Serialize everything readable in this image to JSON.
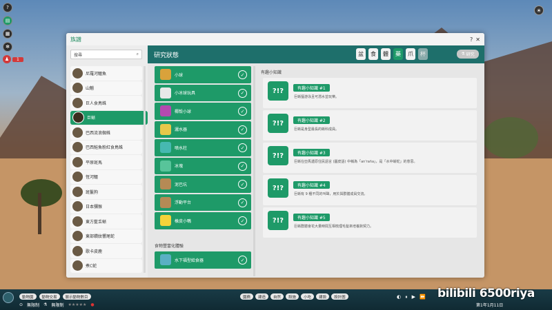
{
  "window": {
    "title": "族譜",
    "help_icon": "?",
    "close_icon": "✕"
  },
  "search": {
    "placeholder": "搜尋"
  },
  "species": [
    {
      "label": "尼羅河鱷魚"
    },
    {
      "label": "山魈"
    },
    {
      "label": "巨人食鳥蛛"
    },
    {
      "label": "巨蜥"
    },
    {
      "label": "巴西流浪蜘蛛"
    },
    {
      "label": "巴西鮭魚粉紅食鳥蛛"
    },
    {
      "label": "平原斑馬"
    },
    {
      "label": "恆河鱷"
    },
    {
      "label": "斑鬣狗"
    },
    {
      "label": "日本獼猴"
    },
    {
      "label": "東方藍舌蜥"
    },
    {
      "label": "東部鑽紋響尾蛇"
    },
    {
      "label": "歌卡皮鹿"
    },
    {
      "label": "煮C蛇"
    }
  ],
  "header": {
    "title": "研究狀態",
    "button": "研究"
  },
  "categories": [
    "盆",
    "食",
    "體",
    "藥",
    "爪",
    "杯"
  ],
  "research_items": [
    {
      "label": "小球",
      "color": "#d9a23b"
    },
    {
      "label": "小冰球玩具",
      "color": "#e8e8e8"
    },
    {
      "label": "椰殼小球",
      "color": "#b54ab0"
    },
    {
      "label": "灑水器",
      "color": "#e8c84a"
    },
    {
      "label": "噴水柱",
      "color": "#46b9b1"
    },
    {
      "label": "冰塊",
      "color": "#58c49a"
    },
    {
      "label": "泥巴坑",
      "color": "#b58a55"
    },
    {
      "label": "浮動平台",
      "color": "#b58a55"
    },
    {
      "label": "橡皮小鴨",
      "color": "#f3d33a"
    }
  ],
  "section2": {
    "label": "食物豐富化體驗",
    "items": [
      {
        "label": "水下福型給食器",
        "color": "#5ab0c4"
      }
    ]
  },
  "trivia": {
    "label": "有趣小知識",
    "cards": [
      {
        "tag": "有趣小知識 #1",
        "text": "巨蜥擅游泳且可潛水並玩樂。"
      },
      {
        "tag": "有趣小知識 #2",
        "text": "巨蜥是身型最長的蜥科成員。"
      },
      {
        "tag": "有趣小知識 #3",
        "text": "巨蜥在亞馬遜原住民語言 (圖皮語) 中稱為「an'raña」，是「水中蜥蛇」的意思。"
      },
      {
        "tag": "有趣小知識 #4",
        "text": "巨蜥有 9 種不同的叫聲，用於與群體成員交流。"
      },
      {
        "tag": "有趣小知識 #5",
        "text": "巨蜥群體會花大量時間互相梳理毛髮來培養默契力。"
      }
    ]
  },
  "bottom": {
    "row1": [
      "動物園",
      "動物交易",
      "展示動物數目"
    ],
    "row2_left": "無限制",
    "row2_mid": "無限制",
    "mid_pills": [
      "園務",
      "建造",
      "自然",
      "設施",
      "小吃",
      "建設",
      "設計圖"
    ],
    "date": "第1年1月11日",
    "watermark": "bilibili 6500riya"
  }
}
